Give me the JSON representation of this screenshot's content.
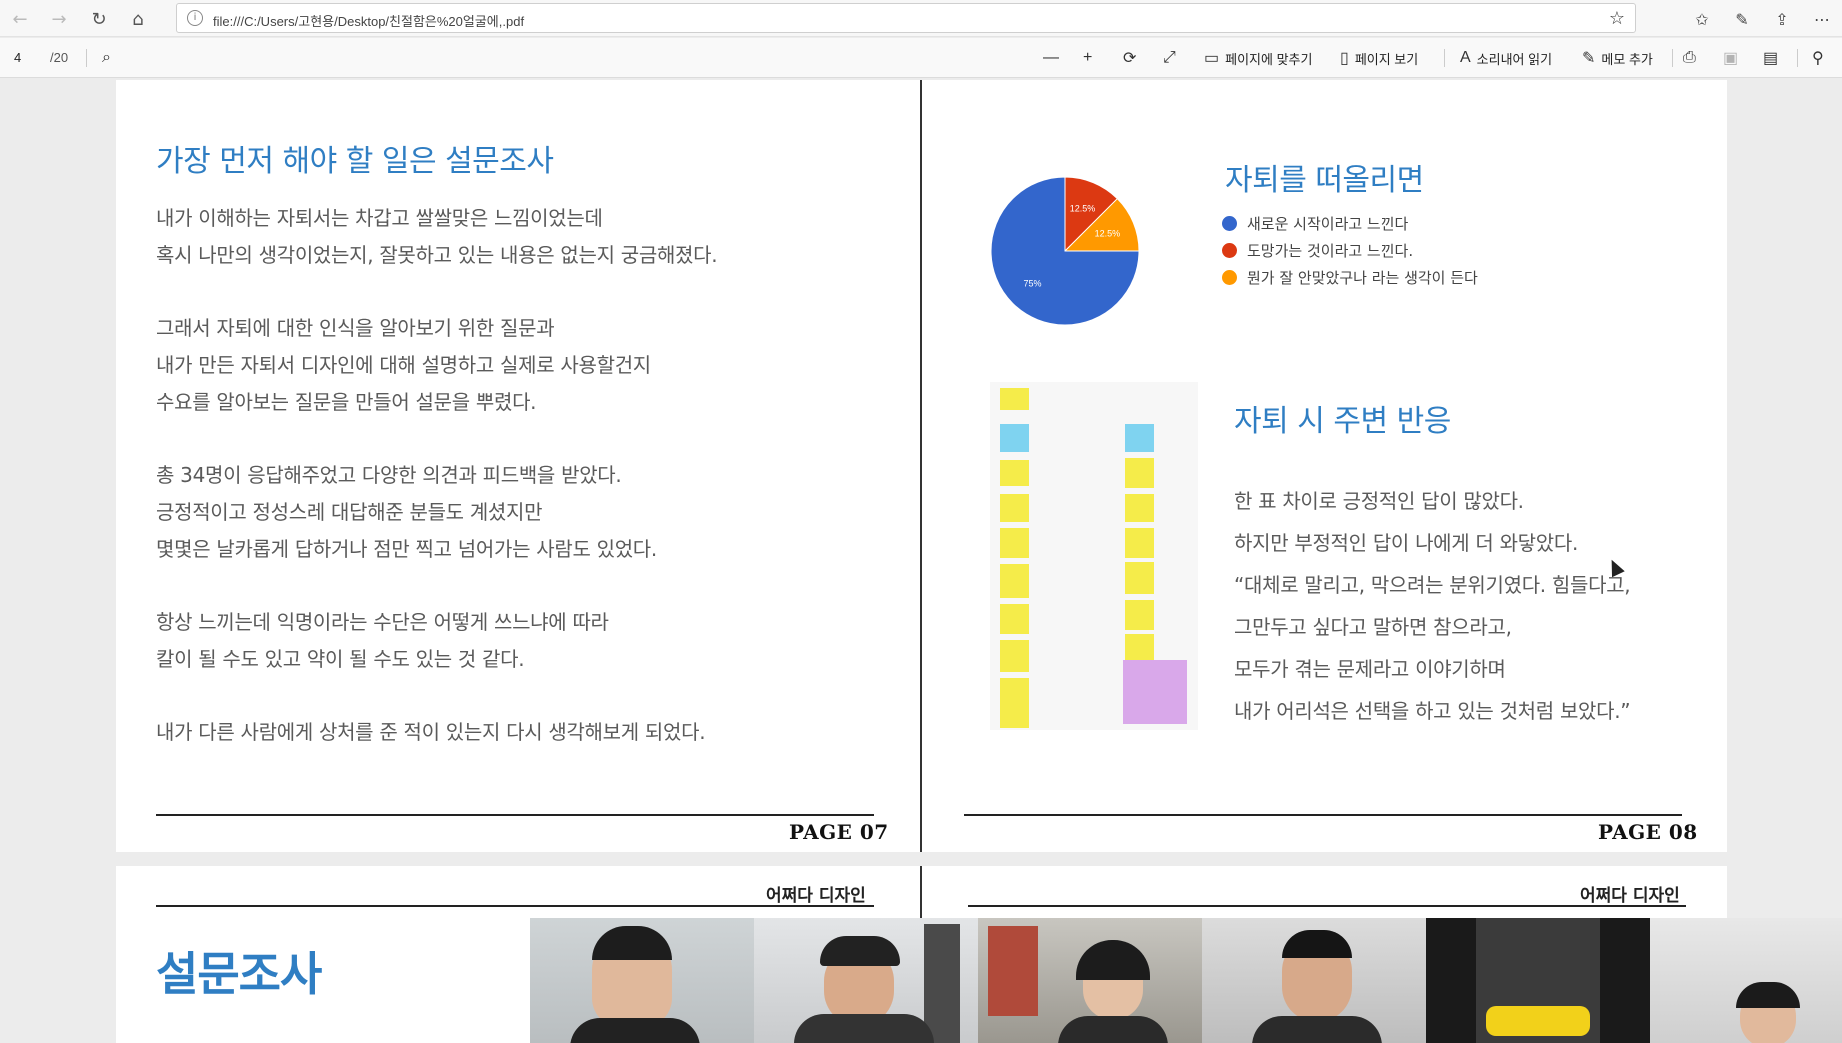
{
  "browser": {
    "url": "file:///C:/Users/고현용/Desktop/친절함은%20얼굴에,.pdf"
  },
  "pdf_toolbar": {
    "current_page": "4",
    "total_pages": "/20",
    "fit_page": "페이지에 맞추기",
    "page_view": "페이지 보기",
    "read_aloud": "소리내어 읽기",
    "add_note": "메모 추가"
  },
  "page07": {
    "title": "가장 먼저 해야 할 일은 설문조사",
    "lines": [
      "내가 이해하는 자퇴서는 차갑고 쌀쌀맞은 느낌이었는데",
      "혹시 나만의 생각이었는지, 잘못하고 있는 내용은 없는지 궁금해졌다.",
      "",
      "그래서 자퇴에 대한 인식을 알아보기 위한 질문과",
      "내가 만든 자퇴서 디자인에 대해 설명하고 실제로 사용할건지",
      "수요를 알아보는 질문을 만들어 설문을 뿌렸다.",
      "",
      "총 34명이 응답해주었고 다양한 의견과 피드백을 받았다.",
      "긍정적이고 정성스레 대답해준 분들도 계셨지만",
      "몇몇은 날카롭게 답하거나 점만 찍고 넘어가는 사람도 있었다.",
      "",
      "항상 느끼는데 익명이라는 수단은 어떻게 쓰느냐에 따라",
      "칼이 될 수도 있고 약이 될 수도 있는 것 같다.",
      "",
      "내가 다른 사람에게 상처를 준 적이 있는지 다시 생각해보게 되었다."
    ],
    "page_label": "PAGE 07"
  },
  "page08": {
    "chart_title": "자퇴를 떠올리면",
    "legend": [
      {
        "label": "새로운 시작이라고 느낀다",
        "color": "#3366cc"
      },
      {
        "label": "도망가는 것이라고 느낀다.",
        "color": "#dc3912"
      },
      {
        "label": "뭔가 잘 안맞았구나 라는 생각이 든다",
        "color": "#ff9900"
      }
    ],
    "reaction_title": "자퇴 시 주변 반응",
    "lines": [
      "한 표 차이로 긍정적인 답이 많았다.",
      "하지만 부정적인 답이 나에게 더 와닿았다.",
      "“대체로 말리고, 막으려는 분위기였다. 힘들다고,",
      "그만두고 싶다고 말하면 참으라고,",
      "모두가 겪는 문제라고 이야기하며",
      "내가 어리석은 선택을 하고 있는 것처럼 보았다.”"
    ],
    "page_label": "PAGE 08"
  },
  "chart_data": {
    "type": "pie",
    "categories": [
      "새로운 시작이라고 느낀다",
      "도망가는 것이라고 느낀다.",
      "뭔가 잘 안맞았구나 라는 생각이 든다"
    ],
    "values": [
      75,
      12.5,
      12.5
    ],
    "labels": [
      "75%",
      "12.5%",
      "12.5%"
    ],
    "colors": [
      "#3366cc",
      "#dc3912",
      "#ff9900"
    ],
    "title": "자퇴를 떠올리면",
    "legend_position": "right"
  },
  "next_pages": {
    "header_left": "어쩌다 디자인",
    "header_right": "어쩌다 디자인",
    "big_title": "설문조사"
  }
}
